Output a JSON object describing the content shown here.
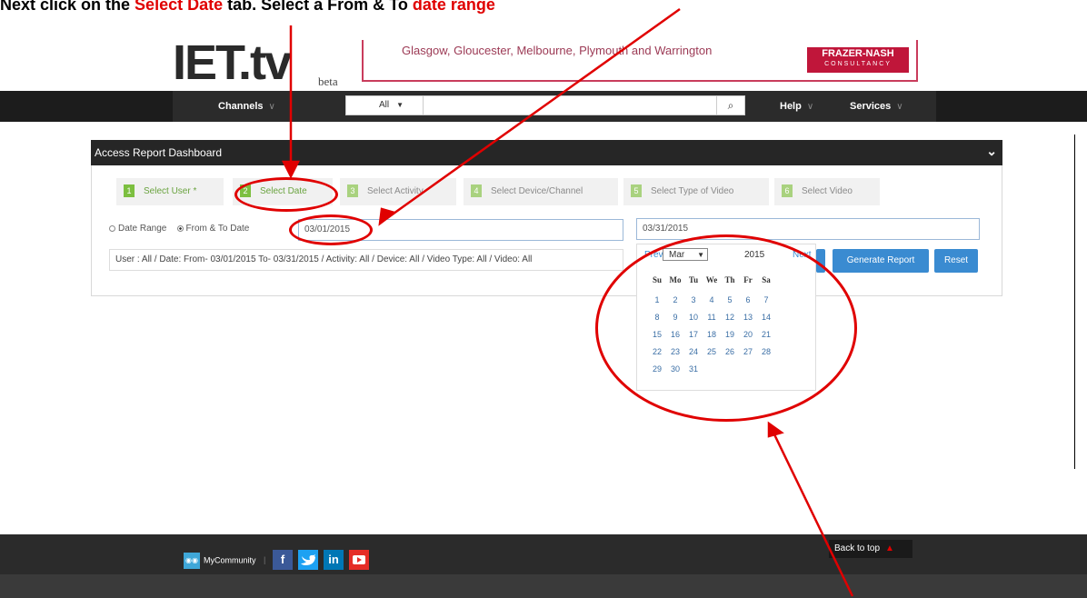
{
  "instruction": {
    "prefix": "Next click on the ",
    "highlight1": "Select Date",
    "middle": " tab. Select a From & To ",
    "highlight2": "date range"
  },
  "header": {
    "logo_text": "IET.tv",
    "beta": "beta",
    "banner_text": "Glasgow, Gloucester, Melbourne, Plymouth and Warrington",
    "banner_brand": "FRAZER-NASH",
    "banner_brand_sub": "CONSULTANCY"
  },
  "nav": {
    "channels": "Channels",
    "search_scope": "All",
    "help": "Help",
    "services": "Services"
  },
  "panel": {
    "title": "Access Report Dashboard",
    "tabs": [
      {
        "num": "1",
        "label": "Select User *"
      },
      {
        "num": "2",
        "label": "Select Date"
      },
      {
        "num": "3",
        "label": "Select Activity"
      },
      {
        "num": "4",
        "label": "Select Device/Channel"
      },
      {
        "num": "5",
        "label": "Select Type of Video"
      },
      {
        "num": "6",
        "label": "Select Video"
      }
    ],
    "radio_date_range": "Date Range",
    "radio_from_to": "From & To Date",
    "from_date": "03/01/2015",
    "to_date": "03/31/2015",
    "summary": "User : All / Date: From- 03/01/2015 To- 03/31/2015 / Activity: All / Device: All / Video Type: All / Video: All",
    "generate_label": "Generate Report",
    "reset_label": "Reset"
  },
  "calendar": {
    "prev": "Prev",
    "next": "Next",
    "month": "Mar",
    "year": "2015",
    "weekdays": [
      "Su",
      "Mo",
      "Tu",
      "We",
      "Th",
      "Fr",
      "Sa"
    ],
    "days": [
      "1",
      "2",
      "3",
      "4",
      "5",
      "6",
      "7",
      "8",
      "9",
      "10",
      "11",
      "12",
      "13",
      "14",
      "15",
      "16",
      "17",
      "18",
      "19",
      "20",
      "21",
      "22",
      "23",
      "24",
      "25",
      "26",
      "27",
      "28",
      "29",
      "30",
      "31"
    ]
  },
  "footer": {
    "community": "MyCommunity",
    "social": [
      "f",
      "t",
      "in",
      "yt"
    ],
    "back_to_top": "Back to top"
  },
  "colors": {
    "annotation": "#e00000",
    "accent_blue": "#3a8bd1",
    "tab_green": "#7cbf40",
    "header_dark": "#262626"
  }
}
